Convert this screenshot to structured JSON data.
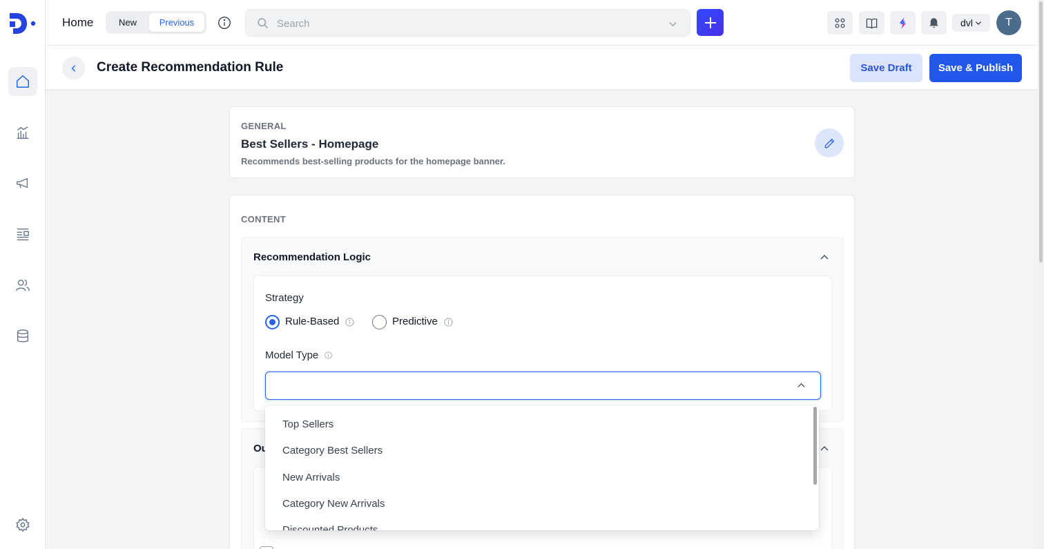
{
  "header": {
    "home_title": "Home",
    "toggle_new": "New",
    "toggle_previous": "Previous",
    "search_placeholder": "Search",
    "workspace": "dvl",
    "avatar_initial": "T"
  },
  "sidebar": {
    "items": [
      {
        "name": "home",
        "icon": "home-icon",
        "active": true
      },
      {
        "name": "analytics",
        "icon": "analytics-icon",
        "active": false
      },
      {
        "name": "campaigns",
        "icon": "megaphone-icon",
        "active": false
      },
      {
        "name": "content",
        "icon": "list-icon",
        "active": false
      },
      {
        "name": "audience",
        "icon": "users-icon",
        "active": false
      },
      {
        "name": "data",
        "icon": "database-icon",
        "active": false
      },
      {
        "name": "settings",
        "icon": "gear-icon",
        "active": false
      }
    ]
  },
  "page": {
    "title": "Create Recommendation Rule",
    "save_draft": "Save Draft",
    "save_publish": "Save & Publish"
  },
  "general": {
    "section_label": "GENERAL",
    "name": "Best Sellers - Homepage",
    "description": "Recommends best-selling products for the homepage banner."
  },
  "content": {
    "section_label": "CONTENT",
    "logic_title": "Recommendation Logic",
    "strategy_label": "Strategy",
    "strategy_options": [
      {
        "label": "Rule-Based",
        "selected": true
      },
      {
        "label": "Predictive",
        "selected": false
      }
    ],
    "model_type_label": "Model Type",
    "model_type_value": "",
    "output_title_partial": "Ou"
  },
  "dropdown": {
    "options": [
      "Top Sellers",
      "Category Best Sellers",
      "New Arrivals",
      "Category New Arrivals",
      "Discounted Products"
    ]
  },
  "colors": {
    "primary": "#2157ea",
    "draft_bg": "#dbe4fc",
    "avatar_bg": "#4b6a8c"
  }
}
